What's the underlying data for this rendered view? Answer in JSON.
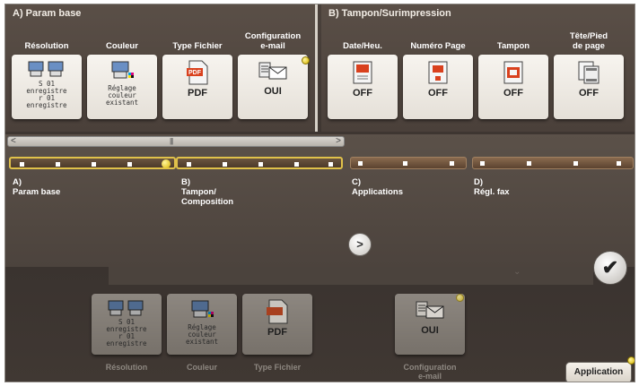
{
  "panel_a": {
    "title": "A)   Param base",
    "functions": [
      {
        "label": "Résolution",
        "value_lines": [
          "S 01",
          "enregistre",
          "r 01",
          "enregistre"
        ]
      },
      {
        "label": "Couleur",
        "value_lines": [
          "Réglage",
          "couleur",
          "existant"
        ]
      },
      {
        "label": "Type Fichier",
        "value": "PDF"
      },
      {
        "label_lines": [
          "Configuration",
          "e-mail"
        ],
        "value": "OUI"
      }
    ]
  },
  "panel_b": {
    "title": "B)   Tampon/Surimpression",
    "functions": [
      {
        "label": "Date/Heu.",
        "value": "OFF"
      },
      {
        "label": "Numéro Page",
        "value": "OFF"
      },
      {
        "label": "Tampon",
        "value": "OFF"
      },
      {
        "label_lines": [
          "Tête/Pied",
          "de page"
        ],
        "value": "OFF"
      }
    ]
  },
  "scrollbar": {
    "left_arrow": "<",
    "right_arrow": ">",
    "thumb": "|||"
  },
  "categories": [
    {
      "letter": "A)",
      "name_lines": [
        "Param base"
      ]
    },
    {
      "letter": "B)",
      "name_lines": [
        "Tampon/",
        "Composition"
      ]
    },
    {
      "letter": "C)",
      "name_lines": [
        "Applications"
      ]
    },
    {
      "letter": "D)",
      "name_lines": [
        "Régl. fax"
      ]
    }
  ],
  "next_button": ">",
  "ok_button": "✔",
  "shortcuts": [
    {
      "label": "Résolution",
      "value_lines": [
        "S 01",
        "enregistre",
        "r 01",
        "enregistre"
      ]
    },
    {
      "label": "Couleur",
      "value_lines": [
        "Réglage",
        "couleur",
        "existant"
      ]
    },
    {
      "label": "Type Fichier",
      "value": "PDF"
    },
    {
      "label_lines": [
        "Configuration",
        "e-mail"
      ],
      "value": "OUI"
    }
  ],
  "application_button": "Application",
  "colors": {
    "accent_yellow": "#e0c14a",
    "icon_red": "#d9411e"
  }
}
